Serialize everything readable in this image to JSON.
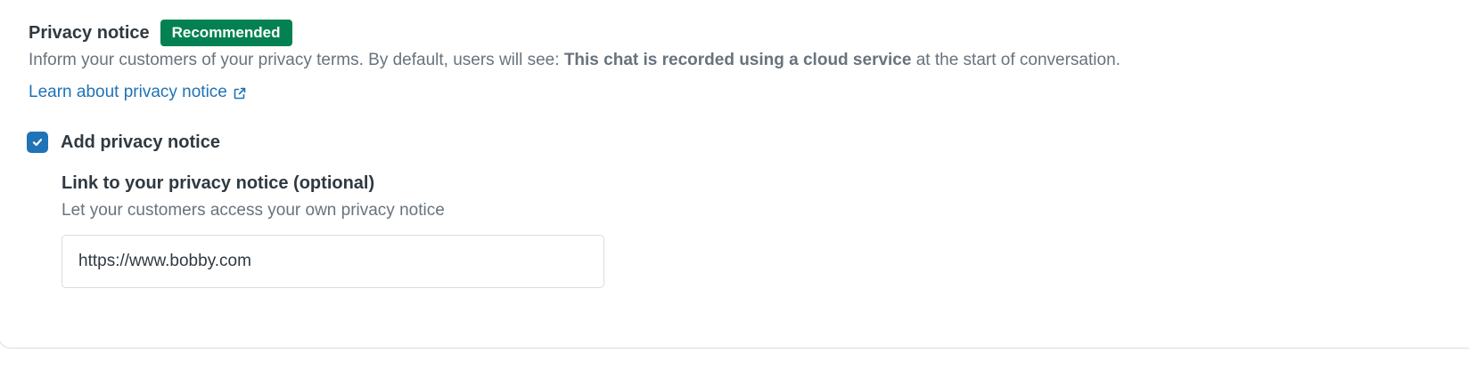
{
  "privacy": {
    "title": "Privacy notice",
    "badge": "Recommended",
    "description_prefix": "Inform your customers of your privacy terms. By default, users will see: ",
    "description_bold": "This chat is recorded using a cloud service",
    "description_suffix": " at the start of conversation.",
    "learn_link": "Learn about privacy notice",
    "learn_link_icon": "external-link-icon"
  },
  "checkbox": {
    "label": "Add privacy notice",
    "checked": true,
    "icon": "checkmark-icon"
  },
  "link_field": {
    "label": "Link to your privacy notice (optional)",
    "hint": "Let your customers access your own privacy notice",
    "value": "https://www.bobby.com"
  },
  "colors": {
    "badge_bg": "#038153",
    "link": "#1f73b7",
    "checkbox_bg": "#1f73b7",
    "text_primary": "#2f3941",
    "text_secondary": "#68737d"
  }
}
